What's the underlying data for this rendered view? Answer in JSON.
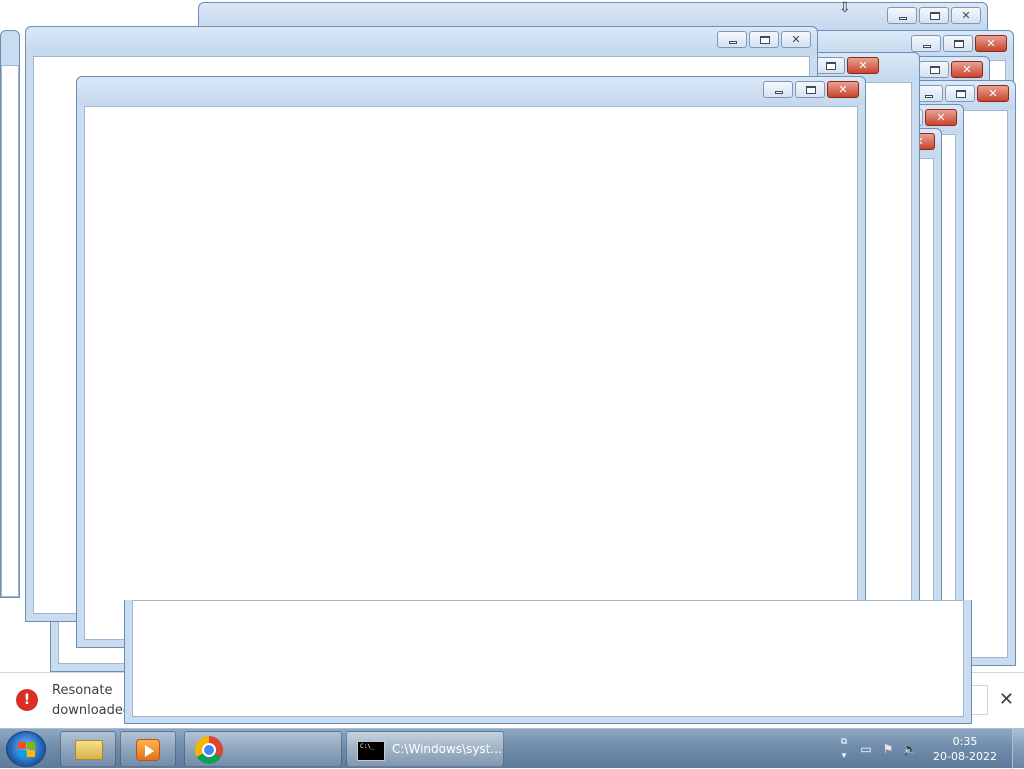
{
  "icons": {
    "window_minimize": "minimize-icon",
    "window_maximize": "maximize-icon",
    "window_close": "close-icon",
    "start": "windows-start-icon",
    "explorer": "folder-icon",
    "media": "media-player-icon",
    "chrome": "chrome-icon",
    "cmd": "command-prompt-icon",
    "error": "error-icon"
  },
  "window_controls": {
    "close_glyph": "✕"
  },
  "download_bar": {
    "line1": "Resonate",
    "line2": "downloaded",
    "error_glyph": "!",
    "close_glyph": "✕"
  },
  "taskbar": {
    "cmd_label": "C:\\Windows\\syst...",
    "cmd_icon_text": "C:\\_"
  },
  "clock": {
    "time": "0:35",
    "date": "20-08-2022"
  },
  "colors": {
    "window_frame": "#c9dcf0",
    "close_button": "#c8442c",
    "error_red": "#d93025",
    "taskbar": "#6f8cab"
  }
}
